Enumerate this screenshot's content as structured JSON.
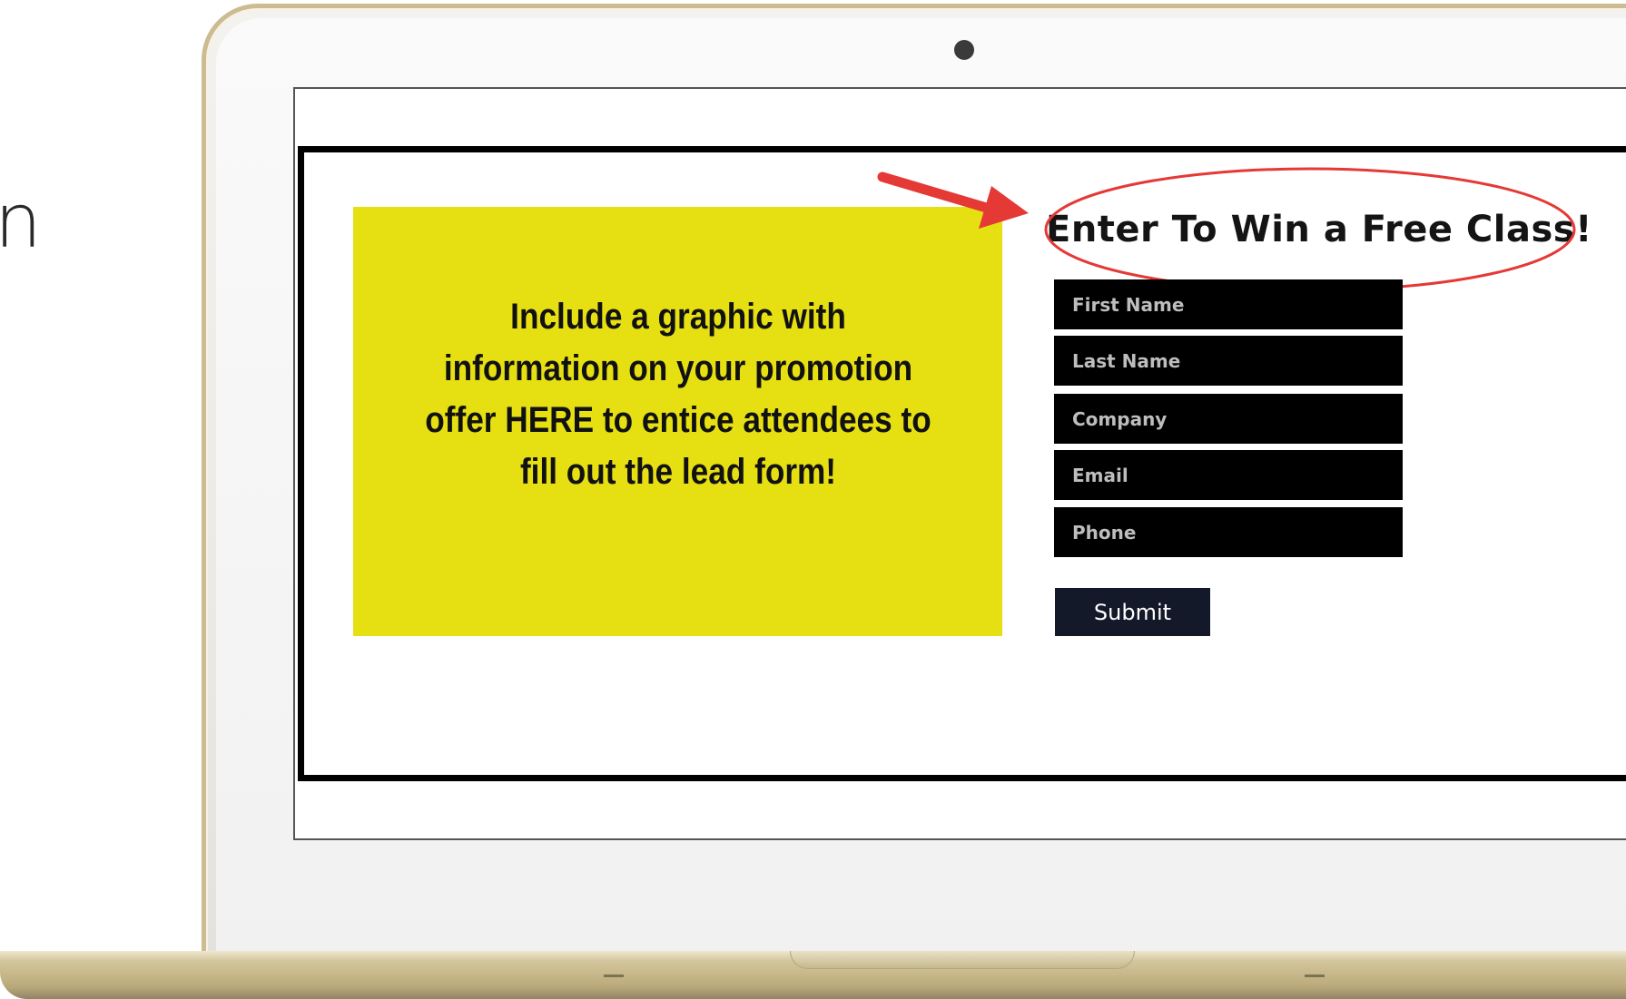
{
  "page": {
    "left_fragment_text": "n"
  },
  "promo": {
    "text": "Include a graphic with information on your promotion offer HERE to entice attendees to fill out the lead form!",
    "background_color": "#e6df12"
  },
  "form": {
    "title": "Enter To Win a Free Class!",
    "fields": [
      {
        "placeholder": "First Name"
      },
      {
        "placeholder": "Last Name"
      },
      {
        "placeholder": "Company"
      },
      {
        "placeholder": "Email"
      },
      {
        "placeholder": "Phone"
      }
    ],
    "submit_label": "Submit",
    "field_color": "#000000",
    "submit_color": "#14192a"
  },
  "annotation": {
    "arrow_color": "#e53935",
    "ellipse_color": "#e53935"
  },
  "icons": {
    "camera": "camera-icon",
    "arrow": "red-arrow-icon"
  }
}
